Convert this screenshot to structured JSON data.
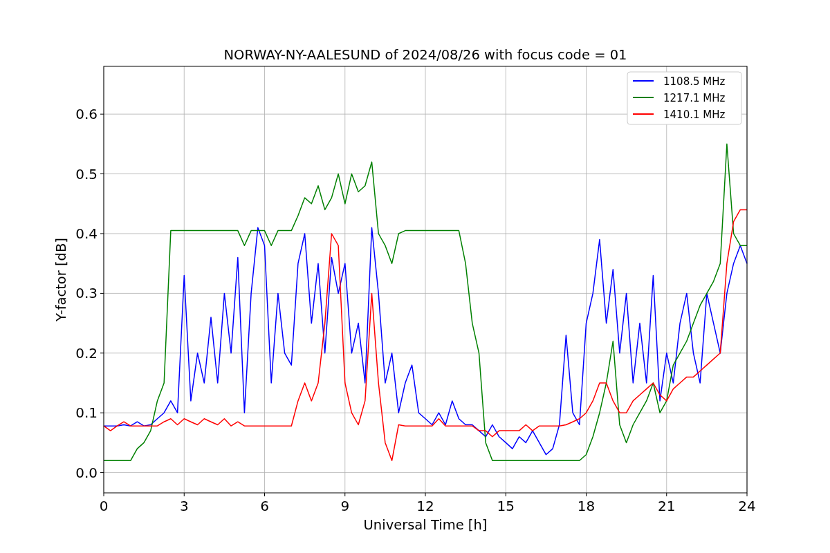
{
  "chart_data": {
    "type": "line",
    "title": "NORWAY-NY-AALESUND of 2024/08/26 with focus code = 01",
    "xlabel": "Universal Time [h]",
    "ylabel": "Y-factor [dB]",
    "x": [
      0,
      0.25,
      0.5,
      0.75,
      1,
      1.25,
      1.5,
      1.75,
      2,
      2.25,
      2.5,
      2.75,
      3,
      3.25,
      3.5,
      3.75,
      4,
      4.25,
      4.5,
      4.75,
      5,
      5.25,
      5.5,
      5.75,
      6,
      6.25,
      6.5,
      6.75,
      7,
      7.25,
      7.5,
      7.75,
      8,
      8.25,
      8.5,
      8.75,
      9,
      9.25,
      9.5,
      9.75,
      10,
      10.25,
      10.5,
      10.75,
      11,
      11.25,
      11.5,
      11.75,
      12,
      12.25,
      12.5,
      12.75,
      13,
      13.25,
      13.5,
      13.75,
      14,
      14.25,
      14.5,
      14.75,
      15,
      15.25,
      15.5,
      15.75,
      16,
      16.25,
      16.5,
      16.75,
      17,
      17.25,
      17.5,
      17.75,
      18,
      18.25,
      18.5,
      18.75,
      19,
      19.25,
      19.5,
      19.75,
      20,
      20.25,
      20.5,
      20.75,
      21,
      21.25,
      21.5,
      21.75,
      22,
      22.25,
      22.5,
      22.75,
      23,
      23.25,
      23.5,
      23.75,
      24
    ],
    "series": [
      {
        "name": "1108.5 MHz",
        "color": "#0000ff",
        "values": [
          0.078,
          0.078,
          0.078,
          0.08,
          0.078,
          0.085,
          0.078,
          0.08,
          0.09,
          0.1,
          0.12,
          0.1,
          0.33,
          0.12,
          0.2,
          0.15,
          0.26,
          0.15,
          0.3,
          0.2,
          0.36,
          0.1,
          0.3,
          0.41,
          0.38,
          0.15,
          0.3,
          0.2,
          0.18,
          0.35,
          0.4,
          0.25,
          0.35,
          0.2,
          0.36,
          0.3,
          0.35,
          0.2,
          0.25,
          0.15,
          0.41,
          0.3,
          0.15,
          0.2,
          0.1,
          0.15,
          0.18,
          0.1,
          0.09,
          0.08,
          0.1,
          0.08,
          0.12,
          0.09,
          0.08,
          0.08,
          0.07,
          0.06,
          0.08,
          0.06,
          0.05,
          0.04,
          0.06,
          0.05,
          0.07,
          0.05,
          0.03,
          0.04,
          0.08,
          0.23,
          0.1,
          0.08,
          0.25,
          0.3,
          0.39,
          0.25,
          0.34,
          0.2,
          0.3,
          0.15,
          0.25,
          0.15,
          0.33,
          0.12,
          0.2,
          0.15,
          0.25,
          0.3,
          0.2,
          0.15,
          0.3,
          0.25,
          0.2,
          0.3,
          0.35,
          0.38,
          0.35
        ]
      },
      {
        "name": "1217.1 MHz",
        "color": "#008000",
        "values": [
          0.02,
          0.02,
          0.02,
          0.02,
          0.02,
          0.04,
          0.05,
          0.07,
          0.12,
          0.15,
          0.405,
          0.405,
          0.405,
          0.405,
          0.405,
          0.405,
          0.405,
          0.405,
          0.405,
          0.405,
          0.405,
          0.38,
          0.405,
          0.405,
          0.405,
          0.38,
          0.405,
          0.405,
          0.405,
          0.43,
          0.46,
          0.45,
          0.48,
          0.44,
          0.46,
          0.5,
          0.45,
          0.5,
          0.47,
          0.48,
          0.52,
          0.4,
          0.38,
          0.35,
          0.4,
          0.405,
          0.405,
          0.405,
          0.405,
          0.405,
          0.405,
          0.405,
          0.405,
          0.405,
          0.35,
          0.25,
          0.2,
          0.05,
          0.02,
          0.02,
          0.02,
          0.02,
          0.02,
          0.02,
          0.02,
          0.02,
          0.02,
          0.02,
          0.02,
          0.02,
          0.02,
          0.02,
          0.03,
          0.06,
          0.1,
          0.15,
          0.22,
          0.08,
          0.05,
          0.08,
          0.1,
          0.12,
          0.15,
          0.1,
          0.12,
          0.18,
          0.2,
          0.22,
          0.25,
          0.28,
          0.3,
          0.32,
          0.35,
          0.55,
          0.4,
          0.38,
          0.38
        ]
      },
      {
        "name": "1410.1 MHz",
        "color": "#ff0000",
        "values": [
          0.078,
          0.07,
          0.078,
          0.085,
          0.078,
          0.078,
          0.078,
          0.078,
          0.078,
          0.085,
          0.09,
          0.08,
          0.09,
          0.085,
          0.08,
          0.09,
          0.085,
          0.08,
          0.09,
          0.078,
          0.085,
          0.078,
          0.078,
          0.078,
          0.078,
          0.078,
          0.078,
          0.078,
          0.078,
          0.12,
          0.15,
          0.12,
          0.15,
          0.25,
          0.4,
          0.38,
          0.15,
          0.1,
          0.08,
          0.12,
          0.3,
          0.15,
          0.05,
          0.02,
          0.08,
          0.078,
          0.078,
          0.078,
          0.078,
          0.078,
          0.09,
          0.078,
          0.078,
          0.078,
          0.078,
          0.078,
          0.07,
          0.07,
          0.06,
          0.07,
          0.07,
          0.07,
          0.07,
          0.08,
          0.07,
          0.078,
          0.078,
          0.078,
          0.078,
          0.08,
          0.085,
          0.09,
          0.1,
          0.12,
          0.15,
          0.15,
          0.12,
          0.1,
          0.1,
          0.12,
          0.13,
          0.14,
          0.15,
          0.13,
          0.12,
          0.14,
          0.15,
          0.16,
          0.16,
          0.17,
          0.18,
          0.19,
          0.2,
          0.35,
          0.42,
          0.44,
          0.44
        ]
      }
    ],
    "grid": true,
    "legend": true,
    "xlim": [
      0,
      24
    ],
    "ylim": [
      -0.034,
      0.68
    ],
    "xticks": [
      0,
      3,
      6,
      9,
      12,
      15,
      18,
      21,
      24
    ],
    "yticks": [
      {
        "value": 0,
        "label": "0.0"
      },
      {
        "value": 0.1,
        "label": "0.1"
      },
      {
        "value": 0.2,
        "label": "0.2"
      },
      {
        "value": 0.3,
        "label": "0.3"
      },
      {
        "value": 0.4,
        "label": "0.4"
      },
      {
        "value": 0.5,
        "label": "0.5"
      },
      {
        "value": 0.6,
        "label": "0.6"
      }
    ]
  }
}
